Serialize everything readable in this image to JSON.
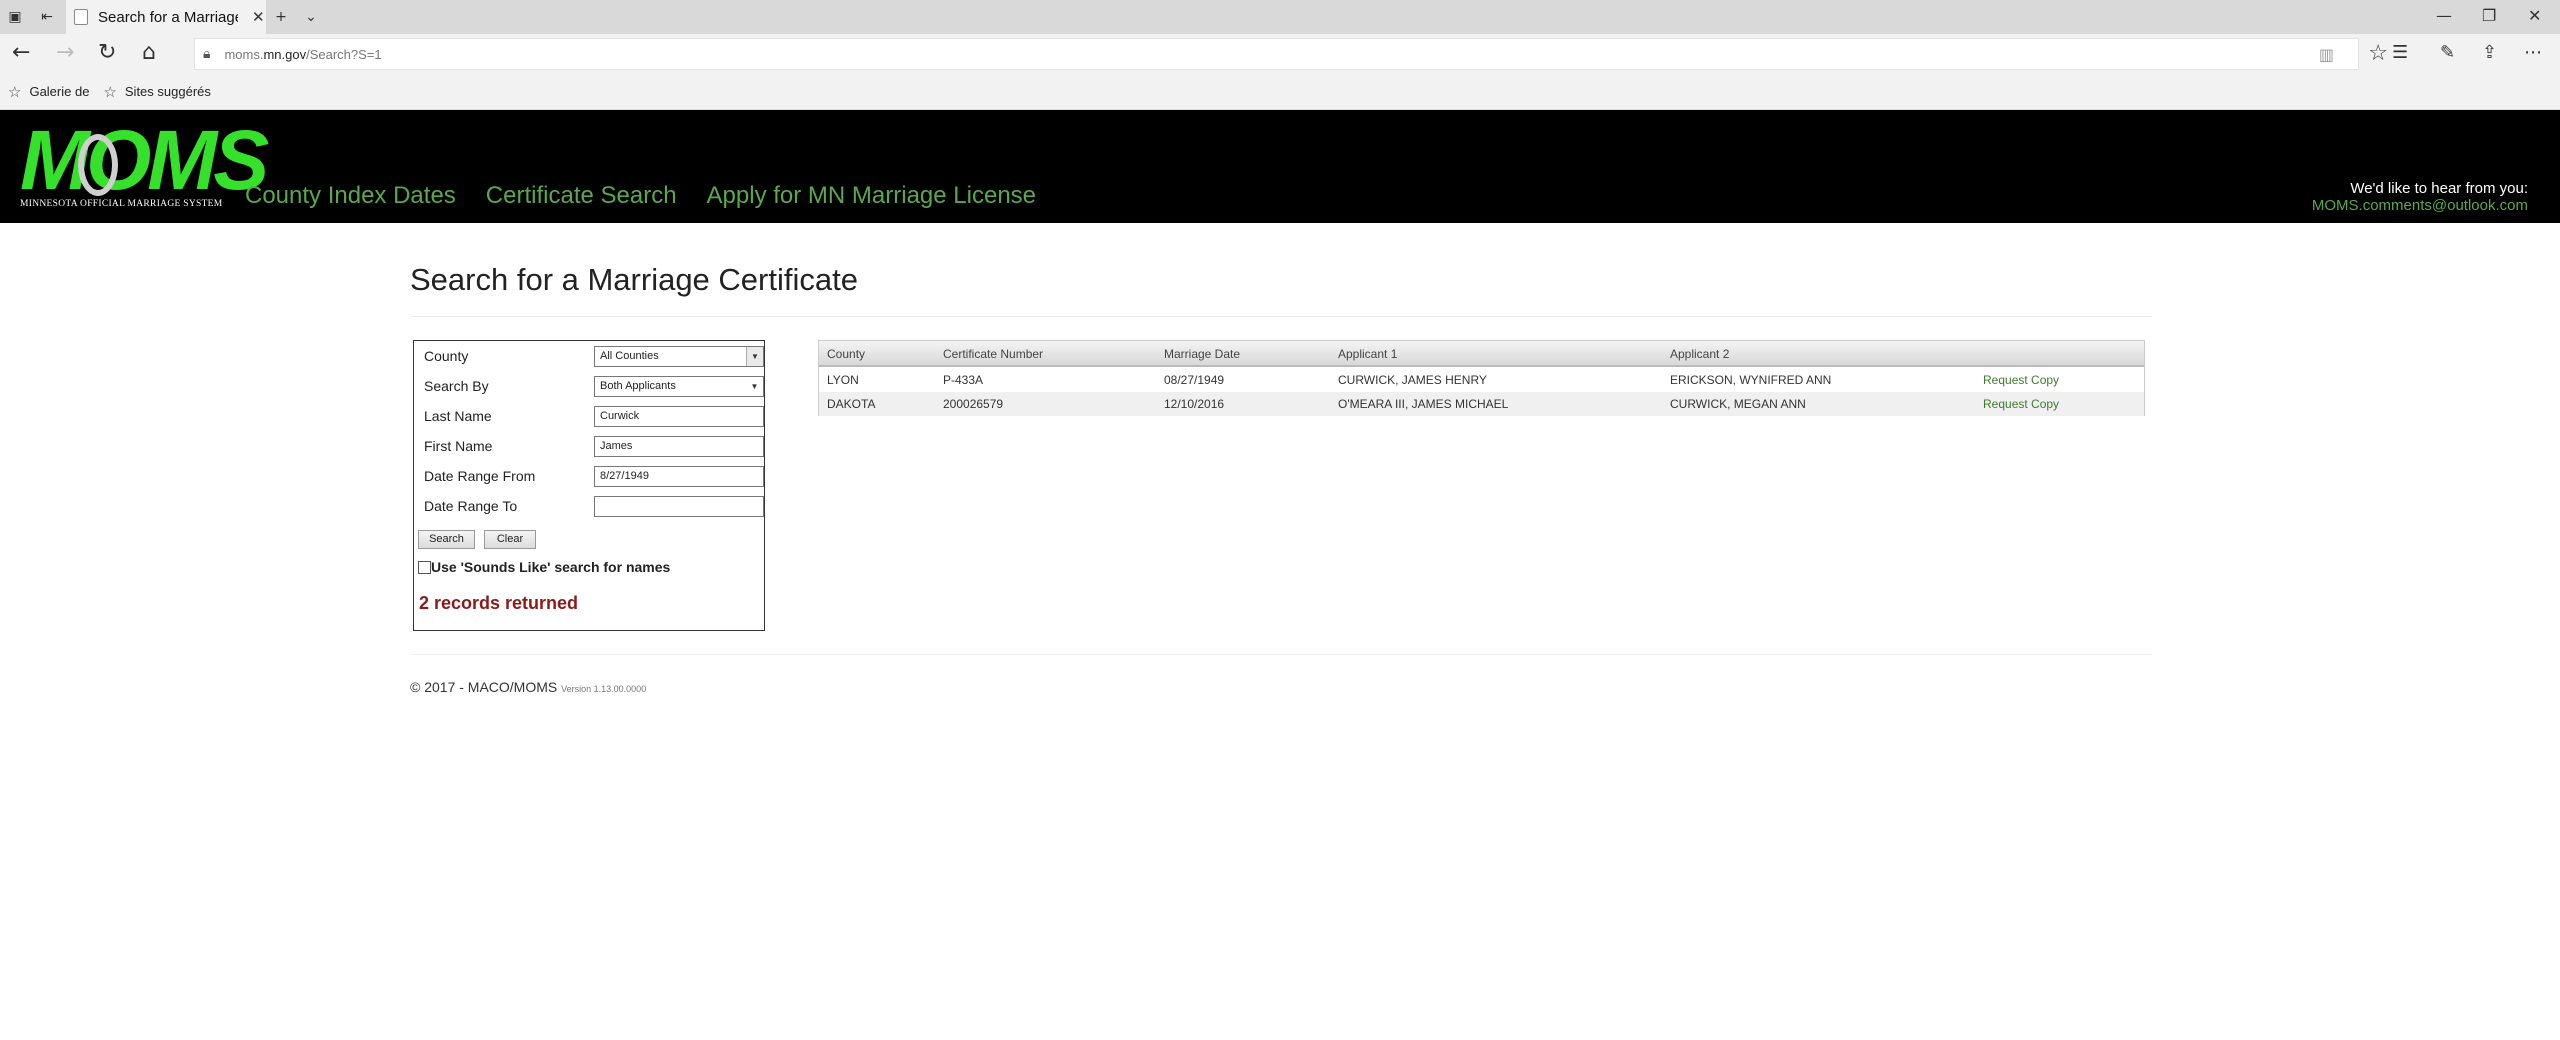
{
  "browser": {
    "tab_title": "Search for a Marriage C",
    "url_prefix": "moms.",
    "url_domain": "mn.gov",
    "url_path": "/Search?S=1",
    "favorites": [
      "Galerie de",
      "Sites suggérés"
    ]
  },
  "site": {
    "logo_text": "MOMS",
    "logo_subtitle": "MINNESOTA OFFICIAL MARRIAGE SYSTEM",
    "nav": [
      "County Index Dates",
      "Certificate Search",
      "Apply for MN Marriage License"
    ],
    "contact_label": "We'd like to hear from you:",
    "contact_email": "MOMS.comments@outlook.com"
  },
  "page": {
    "title": "Search for a Marriage Certificate"
  },
  "form": {
    "county_label": "County",
    "county_value": "All Counties",
    "search_by_label": "Search By",
    "search_by_value": "Both Applicants",
    "last_name_label": "Last Name",
    "last_name_value": "Curwick",
    "first_name_label": "First Name",
    "first_name_value": "James",
    "date_from_label": "Date Range From",
    "date_from_value": "8/27/1949",
    "date_to_label": "Date Range To",
    "date_to_value": "",
    "search_button": "Search",
    "clear_button": "Clear",
    "sounds_like_label": "Use 'Sounds Like' search for names",
    "sounds_like_checked": false,
    "records_returned": "2 records returned"
  },
  "results": {
    "columns": [
      "County",
      "Certificate Number",
      "Marriage Date",
      "Applicant 1",
      "Applicant 2"
    ],
    "rows": [
      {
        "county": "LYON",
        "certificate": "P-433A",
        "date": "08/27/1949",
        "applicant1": "CURWICK, JAMES HENRY",
        "applicant2": "ERICKSON, WYNIFRED ANN",
        "action": "Request Copy"
      },
      {
        "county": "DAKOTA",
        "certificate": "200026579",
        "date": "12/10/2016",
        "applicant1": "O'MEARA III, JAMES MICHAEL",
        "applicant2": "CURWICK, MEGAN ANN",
        "action": "Request Copy"
      }
    ]
  },
  "footer": {
    "copyright": "© 2017 - MACO/MOMS",
    "version": "Version 1.13.00.0000"
  },
  "colors": {
    "header_bg": "#000000",
    "logo_green": "#35e12a",
    "link_green": "#5aa84d",
    "records_red": "#8b1a1a"
  }
}
